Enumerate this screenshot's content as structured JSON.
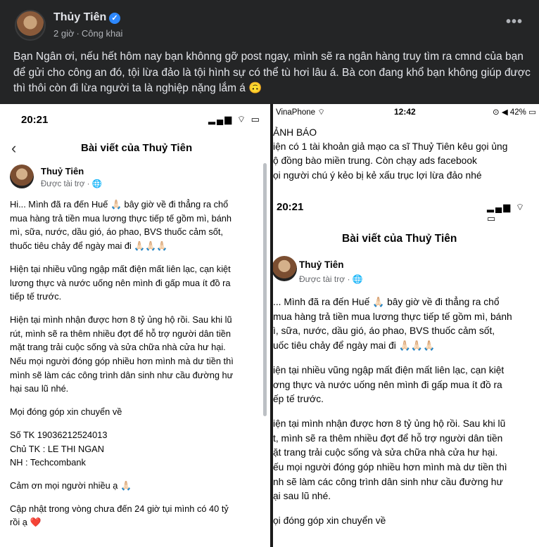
{
  "post": {
    "author": "Thủy Tiên",
    "time": "2 giờ",
    "separator": "·",
    "privacy": "Công khai",
    "more_label": "•••",
    "text": "Bạn Ngân ơi, nếu hết hôm nay bạn khônng gỡ post ngay, mình sẽ ra ngân hàng truy tìm ra cmnd của bạn để gửi cho công an đó, tội lừa đảo là tội hình sự có thể tù hơi lâu á. Bà con đang khổ bạn không giúp được thì thôi còn đi lừa người ta là nghiệp nặng lắm á 🙃"
  },
  "left_shot": {
    "time": "20:21",
    "icons": "▂▄▆ ⌔ ▭",
    "back": "‹",
    "nav_title": "Bài viết của Thuỷ Tiên",
    "author": "Thuỷ Tiên",
    "sub": "Được tài trợ · 🌐",
    "lines": [
      "Hi... Mình đã ra đến Huế 🙏🏻 bây giờ về đi thẳng ra chổ",
      "mua hàng trả tiền mua lương thực tiếp tế gồm mì, bánh",
      "mì, sữa, nước, dầu gió, áo phao, BVS thuốc cảm sốt,",
      "thuốc tiêu chảy để ngày mai đi 🙏🏻🙏🏻🙏🏻",
      "",
      "Hiện tại nhiều vũng ngập mất điện mất liên lạc, cạn kiệt",
      "lương thực và nước uống nên mình đi gấp mua ít đồ ra",
      "tiếp tế trước.",
      "",
      "Hiện tại mình nhận được hơn 8 tỷ ủng hộ rồi. Sau khi lũ",
      "rút, mình sẽ ra thêm nhiều đợt để hỗ trợ người dân tiền",
      "mặt trang trải cuộc sống và sửa chữa nhà cửa hư hại.",
      "Nếu mọi người đóng góp nhiều hơn mình mà dư tiền thì",
      "mình sẽ làm các công trình dân sinh như cầu đường hư",
      "hại sau lũ nhé.",
      "",
      "Mọi đóng góp xin chuyển về",
      "",
      "Số TK 19036212524013",
      "Chủ TK : LE THI NGAN",
      "NH : Techcombank",
      "",
      "Cảm ơn mọi người nhiều ạ 🙏🏻",
      "",
      "Cập nhật trong vòng chưa đến 24 giờ tụi mình có 40 tỷ",
      "rồi ạ ❤️"
    ]
  },
  "right_shot": {
    "carrier": "VinaPhone ⌔",
    "time": "12:42",
    "battery": "⊙ ◀ 42% ▭",
    "warning_lines": [
      "ẢNH BÁO",
      "iện có 1 tài khoản giả mạo ca sĩ Thuỷ Tiên kêu gọi ủng",
      "ộ đồng bào miền trung. Còn chạy ads facebook",
      "ọi người chú ý kẻo bị kẻ xấu trục lợi lừa đảo nhé"
    ],
    "inner_time": "20:21",
    "inner_icons": "▂▄▆ ⌔ ▭",
    "nav_title": "Bài viết của Thuỷ Tiên",
    "author": "Thuỷ Tiên",
    "sub": "Được tài trợ · 🌐",
    "lines": [
      "... Mình đã ra đến Huế 🙏🏻 bây giờ về đi thẳng ra chổ",
      "mua hàng trả tiền mua lương thực tiếp tế gồm mì, bánh",
      "ì, sữa, nước, dầu gió, áo phao, BVS thuốc cảm sốt,",
      "uốc tiêu chảy để ngày mai đi 🙏🏻🙏🏻🙏🏻",
      "",
      "iện tại nhiều vũng ngập mất điện mất liên lạc, cạn kiệt",
      "ơng thực và nước uống nên mình đi gấp mua ít đồ ra",
      "ếp tế trước.",
      "",
      "iện tại mình nhận được hơn 8 tỷ ủng hộ rồi. Sau khi lũ",
      "t, mình sẽ ra thêm nhiều đợt để hỗ trợ người dân tiền",
      "ặt trang trải cuộc sống và sửa chữa nhà cửa hư hại.",
      "ếu mọi người đóng góp nhiều hơn mình mà dư tiền thì",
      "nh sẽ làm các công trình dân sinh như cầu đường hư",
      "ại sau lũ nhé.",
      "",
      "ọi đóng góp xin chuyển về"
    ]
  }
}
